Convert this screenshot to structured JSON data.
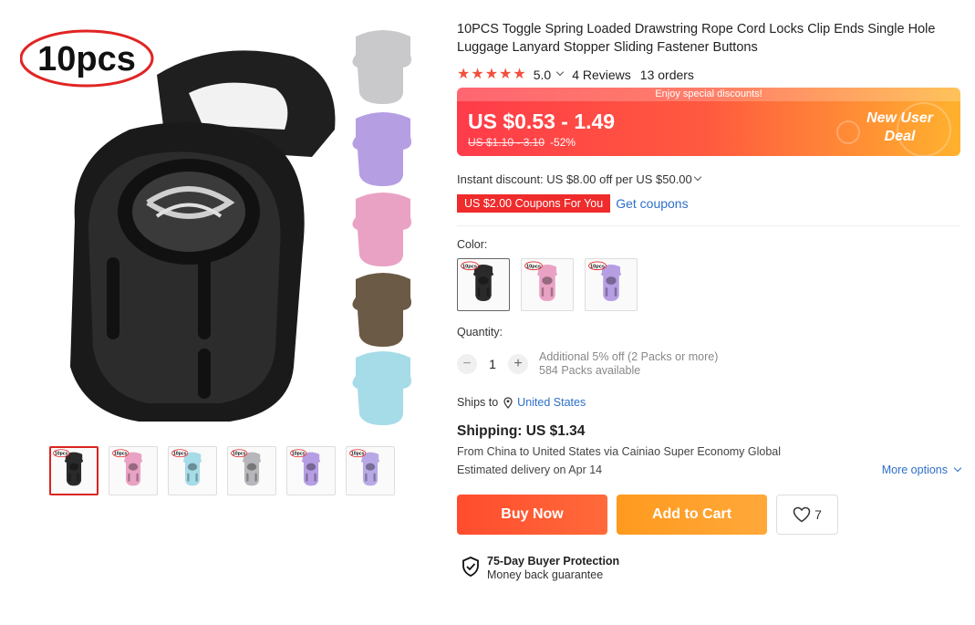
{
  "gallery": {
    "badge": "10pcs",
    "thumb_badge": "10pcs",
    "thumbnails": [
      {
        "icon": "black-cord-lock",
        "color": "#2a2a2a"
      },
      {
        "icon": "pink-cord-lock",
        "color": "#e9a2c4"
      },
      {
        "icon": "blue-cord-lock",
        "color": "#a6dbe8"
      },
      {
        "icon": "gray-cord-lock",
        "color": "#b7b7bb"
      },
      {
        "icon": "purple-cord-lock",
        "color": "#b69ee3"
      },
      {
        "icon": "size-chart-cord-lock",
        "color": "#b8a9e6"
      }
    ],
    "side_colors": [
      "#c9c9cc",
      "#b69ee3",
      "#e9a2c4",
      "#6b5a46",
      "#a6dbe8"
    ]
  },
  "product": {
    "title": "10PCS Toggle Spring Loaded Drawstring Rope Cord Locks Clip Ends Single Hole Luggage Lanyard Stopper Sliding Fastener Buttons",
    "rating": "5.0",
    "reviews": "4 Reviews",
    "orders": "13 orders"
  },
  "price": {
    "banner": "Enjoy special discounts!",
    "current": "US $0.53 - 1.49",
    "original": "US $1.10 - 3.10",
    "discount": "-52%",
    "deal_line1": "New User",
    "deal_line2": "Deal",
    "colors": {
      "start": "#ff3b4a",
      "end": "#ffb22e"
    }
  },
  "discounts": {
    "instant": "Instant discount: US $8.00 off per US $50.00",
    "coupon_tag": "US $2.00 Coupons For You",
    "get_coupons": "Get coupons"
  },
  "variants": {
    "label": "Color:",
    "swatches": [
      {
        "icon": "black-cord-lock",
        "color": "#2a2a2a"
      },
      {
        "icon": "pink-cord-lock",
        "color": "#e9a2c4"
      },
      {
        "icon": "purple-cord-lock",
        "color": "#b69ee3"
      }
    ]
  },
  "quantity": {
    "label": "Quantity:",
    "value": "1",
    "minus": "−",
    "plus": "+",
    "offer": "Additional 5% off (2 Packs or more)",
    "available": "584 Packs available"
  },
  "shipping": {
    "ships_to_label": "Ships to",
    "country": "United States",
    "title": "Shipping: US $1.34",
    "route": "From China to United States via Cainiao Super Economy Global",
    "delivery": "Estimated delivery on Apr 14",
    "more_options": "More options"
  },
  "actions": {
    "buy_now": "Buy Now",
    "add_to_cart": "Add to Cart",
    "wishlist_count": "7"
  },
  "protection": {
    "title": "75-Day Buyer Protection",
    "subtitle": "Money back guarantee"
  }
}
